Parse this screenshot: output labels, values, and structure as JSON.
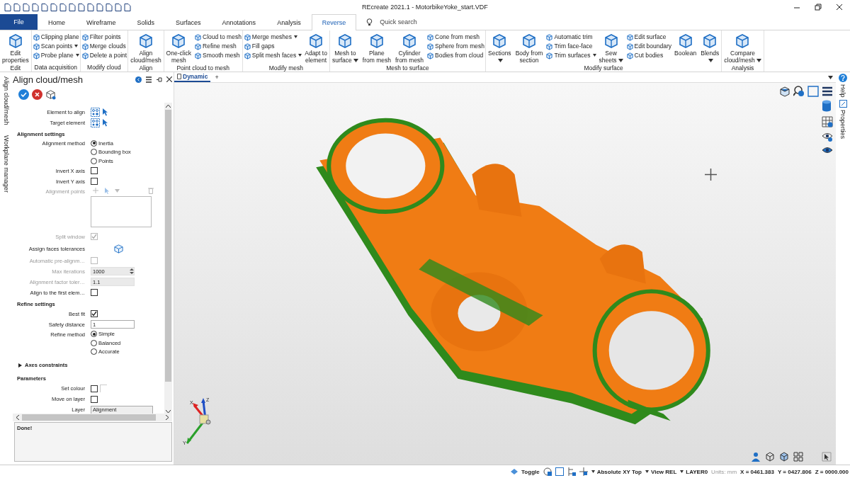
{
  "title_bar": {
    "title": "REcreate 2021.1 - MotorbikeYoke_start.VDF"
  },
  "tabs": [
    {
      "label": "File",
      "kind": "file",
      "selected": false
    },
    {
      "label": "Home",
      "kind": "tab",
      "selected": false
    },
    {
      "label": "Wireframe",
      "kind": "tab",
      "selected": false
    },
    {
      "label": "Solids",
      "kind": "tab",
      "selected": false
    },
    {
      "label": "Surfaces",
      "kind": "tab",
      "selected": false
    },
    {
      "label": "Annotations",
      "kind": "tab",
      "selected": false
    },
    {
      "label": "Analysis",
      "kind": "tab",
      "selected": false
    },
    {
      "label": "Reverse",
      "kind": "tab",
      "selected": true
    }
  ],
  "quick_search": {
    "placeholder": "Quick search"
  },
  "ribbon_groups": [
    {
      "label": "Edit",
      "items": [
        {
          "label": "Edit\nproperties",
          "kind": "large",
          "dropdown": false
        }
      ]
    },
    {
      "label": "Data acquisition",
      "items": [
        {
          "label": "Clipping plane",
          "kind": "small",
          "dropdown": false
        },
        {
          "label": "Scan points",
          "kind": "small",
          "dropdown": true
        },
        {
          "label": "Probe plane",
          "kind": "small",
          "dropdown": true
        }
      ]
    },
    {
      "label": "Modify cloud",
      "items": [
        {
          "label": "Filter points",
          "kind": "small",
          "dropdown": false
        },
        {
          "label": "Merge clouds",
          "kind": "small",
          "dropdown": false
        },
        {
          "label": "Delete a point",
          "kind": "small",
          "dropdown": false
        }
      ]
    },
    {
      "label": "Align",
      "items": [
        {
          "label": "Align\ncloud/mesh",
          "kind": "large",
          "dropdown": false
        }
      ]
    },
    {
      "label": "Point cloud to mesh",
      "items": [
        {
          "label": "One-click\nmesh",
          "kind": "large",
          "dropdown": false
        },
        {
          "label": "Cloud to mesh",
          "kind": "small",
          "dropdown": false
        },
        {
          "label": "Refine mesh",
          "kind": "small",
          "dropdown": false
        },
        {
          "label": "Smooth mesh",
          "kind": "small",
          "dropdown": false
        }
      ]
    },
    {
      "label": "Modify mesh",
      "items": [
        {
          "label": "Merge meshes",
          "kind": "small",
          "dropdown": true
        },
        {
          "label": "Fill gaps",
          "kind": "small",
          "dropdown": false
        },
        {
          "label": "Split mesh faces",
          "kind": "small",
          "dropdown": true
        },
        {
          "label": "Adapt to\nelement",
          "kind": "large",
          "dropdown": false
        }
      ]
    },
    {
      "label": "Mesh to surface",
      "items": [
        {
          "label": "Mesh to\nsurface",
          "kind": "large",
          "dropdown": true
        },
        {
          "label": "Plane\nfrom mesh",
          "kind": "large",
          "dropdown": false
        },
        {
          "label": "Cylinder\nfrom mesh",
          "kind": "large",
          "dropdown": false
        },
        {
          "label": "Cone from mesh",
          "kind": "small",
          "dropdown": false
        },
        {
          "label": "Sphere from mesh",
          "kind": "small",
          "dropdown": false
        },
        {
          "label": "Bodies from cloud",
          "kind": "small",
          "dropdown": false
        }
      ]
    },
    {
      "label": "Modify surface",
      "items": [
        {
          "label": "Sections\n",
          "kind": "large",
          "dropdown": true
        },
        {
          "label": "Body from\nsection",
          "kind": "large",
          "dropdown": false
        },
        {
          "label": "Automatic trim",
          "kind": "small",
          "dropdown": false
        },
        {
          "label": "Trim face-face",
          "kind": "small",
          "dropdown": false
        },
        {
          "label": "Trim surfaces",
          "kind": "small",
          "dropdown": true
        },
        {
          "label": "Sew\nsheets",
          "kind": "large",
          "dropdown": true
        },
        {
          "label": "Edit surface",
          "kind": "small",
          "dropdown": false
        },
        {
          "label": "Edit boundary",
          "kind": "small",
          "dropdown": false
        },
        {
          "label": "Cut bodies",
          "kind": "small",
          "dropdown": false
        },
        {
          "label": "Boolean\n",
          "kind": "large",
          "dropdown": false
        },
        {
          "label": "Blends\n",
          "kind": "large",
          "dropdown": true
        }
      ]
    },
    {
      "label": "Analysis",
      "items": [
        {
          "label": "Compare\ncloud/mesh",
          "kind": "large",
          "dropdown": true
        }
      ]
    }
  ],
  "side_tabs": [
    "Align cloud/mesh",
    "Workplane manager"
  ],
  "panel": {
    "title": "Align cloud/mesh",
    "rows": [
      {
        "kind": "picker",
        "label": "Element to align"
      },
      {
        "kind": "picker",
        "label": "Target element"
      },
      {
        "kind": "section",
        "label": "Alignment settings"
      },
      {
        "kind": "radio",
        "label": "Alignment method",
        "options": [
          {
            "label": "Inertia",
            "selected": true
          },
          {
            "label": "Bounding box",
            "selected": false
          },
          {
            "label": "Points",
            "selected": false
          }
        ]
      },
      {
        "kind": "checkbox",
        "label": "Invert X axis",
        "checked": false,
        "disabled": false
      },
      {
        "kind": "checkbox",
        "label": "Invert Y axis",
        "checked": false,
        "disabled": false
      },
      {
        "kind": "points",
        "label": "Alignment points",
        "disabled": true
      },
      {
        "kind": "checkbox",
        "label": "Split window",
        "checked": true,
        "disabled": true
      },
      {
        "kind": "tolerance",
        "label": "Assign faces tolerances"
      },
      {
        "kind": "checkbox",
        "label": "Automatic pre-alignm…",
        "checked": false,
        "disabled": true
      },
      {
        "kind": "spin",
        "label": "Max iterations",
        "value": "1000",
        "disabled": true
      },
      {
        "kind": "input",
        "label": "Alignment factor toler…",
        "value": "1.1",
        "disabled": true
      },
      {
        "kind": "checkbox",
        "label": "Align to the first elem…",
        "checked": false,
        "disabled": false
      },
      {
        "kind": "section",
        "label": "Refine settings"
      },
      {
        "kind": "checkbox",
        "label": "Best fit",
        "checked": true,
        "disabled": false
      },
      {
        "kind": "input",
        "label": "Safety distance",
        "value": "1",
        "disabled": false
      },
      {
        "kind": "radio",
        "label": "Refine method",
        "options": [
          {
            "label": "Simple",
            "selected": true
          },
          {
            "label": "Balanced",
            "selected": false
          },
          {
            "label": "Accurate",
            "selected": false
          }
        ]
      },
      {
        "kind": "expander",
        "label": "Axes constraints",
        "expanded": false
      },
      {
        "kind": "section",
        "label": "Parameters"
      },
      {
        "kind": "color",
        "label": "Set colour",
        "checked": false
      },
      {
        "kind": "checkbox",
        "label": "Move on layer",
        "checked": false,
        "disabled": false
      },
      {
        "kind": "select",
        "label": "Layer",
        "value": "Alignment"
      }
    ],
    "message": "Done!"
  },
  "document_tabs": [
    {
      "label": "Dynamic",
      "selected": true
    }
  ],
  "new_tab": "+",
  "right_tabs": [
    "Help",
    "Properties"
  ],
  "triad": {
    "x": "X",
    "y": "Y",
    "z": "Z"
  },
  "status_bar": [
    {
      "label": "Toggle",
      "kind": "text",
      "dropdown": false
    },
    {
      "label": "Absolute XY Top",
      "kind": "text",
      "dropdown": true
    },
    {
      "label": "View REL",
      "kind": "text",
      "dropdown": true
    },
    {
      "label": "LAYER0",
      "kind": "text",
      "dropdown": true
    },
    {
      "label": "Units: mm",
      "kind": "muted",
      "dropdown": false
    },
    {
      "label": "X = 0461.383",
      "kind": "text",
      "dropdown": false
    },
    {
      "label": "Y = 0427.806",
      "kind": "text",
      "dropdown": false
    },
    {
      "label": "Z = 0000.000",
      "kind": "text",
      "dropdown": false
    }
  ]
}
